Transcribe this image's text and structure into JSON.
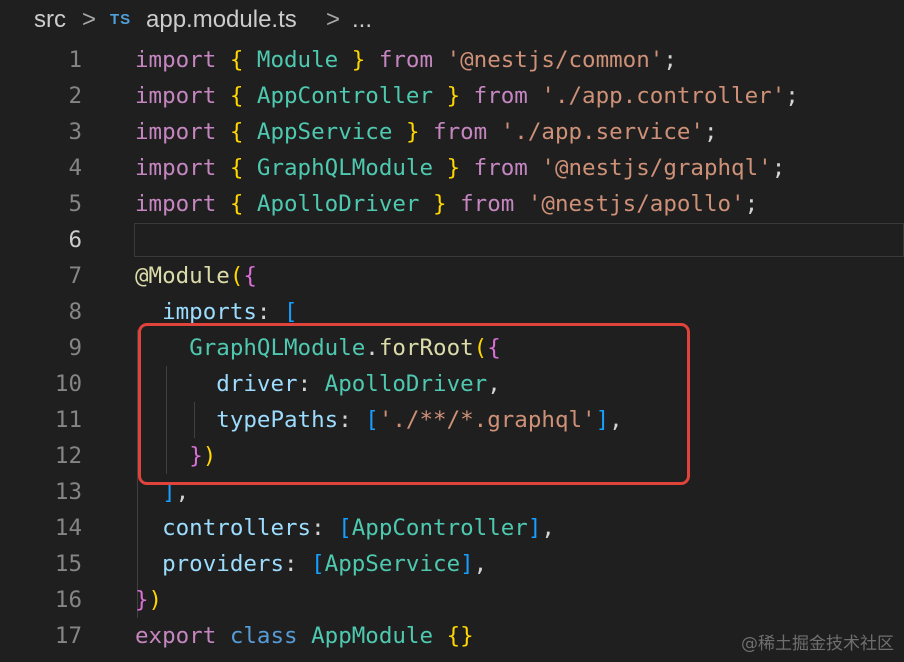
{
  "breadcrumb": {
    "folder": "src",
    "separator": ">",
    "file_icon": "TS",
    "file_icon_name": "typescript-file-icon",
    "file": "app.module.ts",
    "symbol": "..."
  },
  "editor": {
    "current_line": 6,
    "lines": [
      {
        "n": "1",
        "tokens": [
          [
            "import",
            "k"
          ],
          [
            " ",
            "p"
          ],
          [
            "{",
            "b1"
          ],
          [
            " Module ",
            "t"
          ],
          [
            "}",
            "b1"
          ],
          [
            " ",
            "p"
          ],
          [
            "from",
            "k"
          ],
          [
            " ",
            "p"
          ],
          [
            "'@nestjs/common'",
            "s"
          ],
          [
            ";",
            "p"
          ]
        ]
      },
      {
        "n": "2",
        "tokens": [
          [
            "import",
            "k"
          ],
          [
            " ",
            "p"
          ],
          [
            "{",
            "b1"
          ],
          [
            " AppController ",
            "t"
          ],
          [
            "}",
            "b1"
          ],
          [
            " ",
            "p"
          ],
          [
            "from",
            "k"
          ],
          [
            " ",
            "p"
          ],
          [
            "'./app.controller'",
            "s"
          ],
          [
            ";",
            "p"
          ]
        ]
      },
      {
        "n": "3",
        "tokens": [
          [
            "import",
            "k"
          ],
          [
            " ",
            "p"
          ],
          [
            "{",
            "b1"
          ],
          [
            " AppService ",
            "t"
          ],
          [
            "}",
            "b1"
          ],
          [
            " ",
            "p"
          ],
          [
            "from",
            "k"
          ],
          [
            " ",
            "p"
          ],
          [
            "'./app.service'",
            "s"
          ],
          [
            ";",
            "p"
          ]
        ]
      },
      {
        "n": "4",
        "tokens": [
          [
            "import",
            "k"
          ],
          [
            " ",
            "p"
          ],
          [
            "{",
            "b1"
          ],
          [
            " GraphQLModule ",
            "t"
          ],
          [
            "}",
            "b1"
          ],
          [
            " ",
            "p"
          ],
          [
            "from",
            "k"
          ],
          [
            " ",
            "p"
          ],
          [
            "'@nestjs/graphql'",
            "s"
          ],
          [
            ";",
            "p"
          ]
        ]
      },
      {
        "n": "5",
        "tokens": [
          [
            "import",
            "k"
          ],
          [
            " ",
            "p"
          ],
          [
            "{",
            "b1"
          ],
          [
            " ApolloDriver ",
            "t"
          ],
          [
            "}",
            "b1"
          ],
          [
            " ",
            "p"
          ],
          [
            "from",
            "k"
          ],
          [
            " ",
            "p"
          ],
          [
            "'@nestjs/apollo'",
            "s"
          ],
          [
            ";",
            "p"
          ]
        ]
      },
      {
        "n": "6",
        "tokens": []
      },
      {
        "n": "7",
        "tokens": [
          [
            "@Module",
            "f"
          ],
          [
            "(",
            "b1"
          ],
          [
            "{",
            "b2"
          ]
        ]
      },
      {
        "n": "8",
        "tokens": [
          [
            "  ",
            "p"
          ],
          [
            "imports",
            "v"
          ],
          [
            ": ",
            "p"
          ],
          [
            "[",
            "b3"
          ]
        ]
      },
      {
        "n": "9",
        "tokens": [
          [
            "    ",
            "p"
          ],
          [
            "GraphQLModule",
            "t"
          ],
          [
            ".",
            "p"
          ],
          [
            "forRoot",
            "f"
          ],
          [
            "(",
            "b1"
          ],
          [
            "{",
            "b2"
          ]
        ]
      },
      {
        "n": "10",
        "tokens": [
          [
            "      ",
            "p"
          ],
          [
            "driver",
            "v"
          ],
          [
            ": ",
            "p"
          ],
          [
            "ApolloDriver",
            "t"
          ],
          [
            ",",
            "p"
          ]
        ]
      },
      {
        "n": "11",
        "tokens": [
          [
            "      ",
            "p"
          ],
          [
            "typePaths",
            "v"
          ],
          [
            ": ",
            "p"
          ],
          [
            "[",
            "b3"
          ],
          [
            "'./**/*.graphql'",
            "s"
          ],
          [
            "]",
            "b3"
          ],
          [
            ",",
            "p"
          ]
        ]
      },
      {
        "n": "12",
        "tokens": [
          [
            "    ",
            "p"
          ],
          [
            "}",
            "b2"
          ],
          [
            ")",
            "b1"
          ]
        ]
      },
      {
        "n": "13",
        "tokens": [
          [
            "  ",
            "p"
          ],
          [
            "]",
            "b3"
          ],
          [
            ",",
            "p"
          ]
        ]
      },
      {
        "n": "14",
        "tokens": [
          [
            "  ",
            "p"
          ],
          [
            "controllers",
            "v"
          ],
          [
            ": ",
            "p"
          ],
          [
            "[",
            "b3"
          ],
          [
            "AppController",
            "t"
          ],
          [
            "]",
            "b3"
          ],
          [
            ",",
            "p"
          ]
        ]
      },
      {
        "n": "15",
        "tokens": [
          [
            "  ",
            "p"
          ],
          [
            "providers",
            "v"
          ],
          [
            ": ",
            "p"
          ],
          [
            "[",
            "b3"
          ],
          [
            "AppService",
            "t"
          ],
          [
            "]",
            "b3"
          ],
          [
            ",",
            "p"
          ]
        ]
      },
      {
        "n": "16",
        "tokens": [
          [
            "}",
            "b2"
          ],
          [
            ")",
            "b1"
          ]
        ]
      },
      {
        "n": "17",
        "tokens": [
          [
            "export",
            "k"
          ],
          [
            " ",
            "p"
          ],
          [
            "class",
            "kw"
          ],
          [
            " ",
            "p"
          ],
          [
            "AppModule",
            "t"
          ],
          [
            " ",
            "p"
          ],
          [
            "{}",
            "b1"
          ]
        ]
      }
    ]
  },
  "colors": {
    "background": "#1f1f1f",
    "keyword": "#c586c0",
    "type": "#4ec9b0",
    "string": "#ce9178",
    "property": "#9cdcfe",
    "function": "#dcdcaa",
    "highlight_box": "#e0433a"
  },
  "watermark": "@稀土掘金技术社区"
}
